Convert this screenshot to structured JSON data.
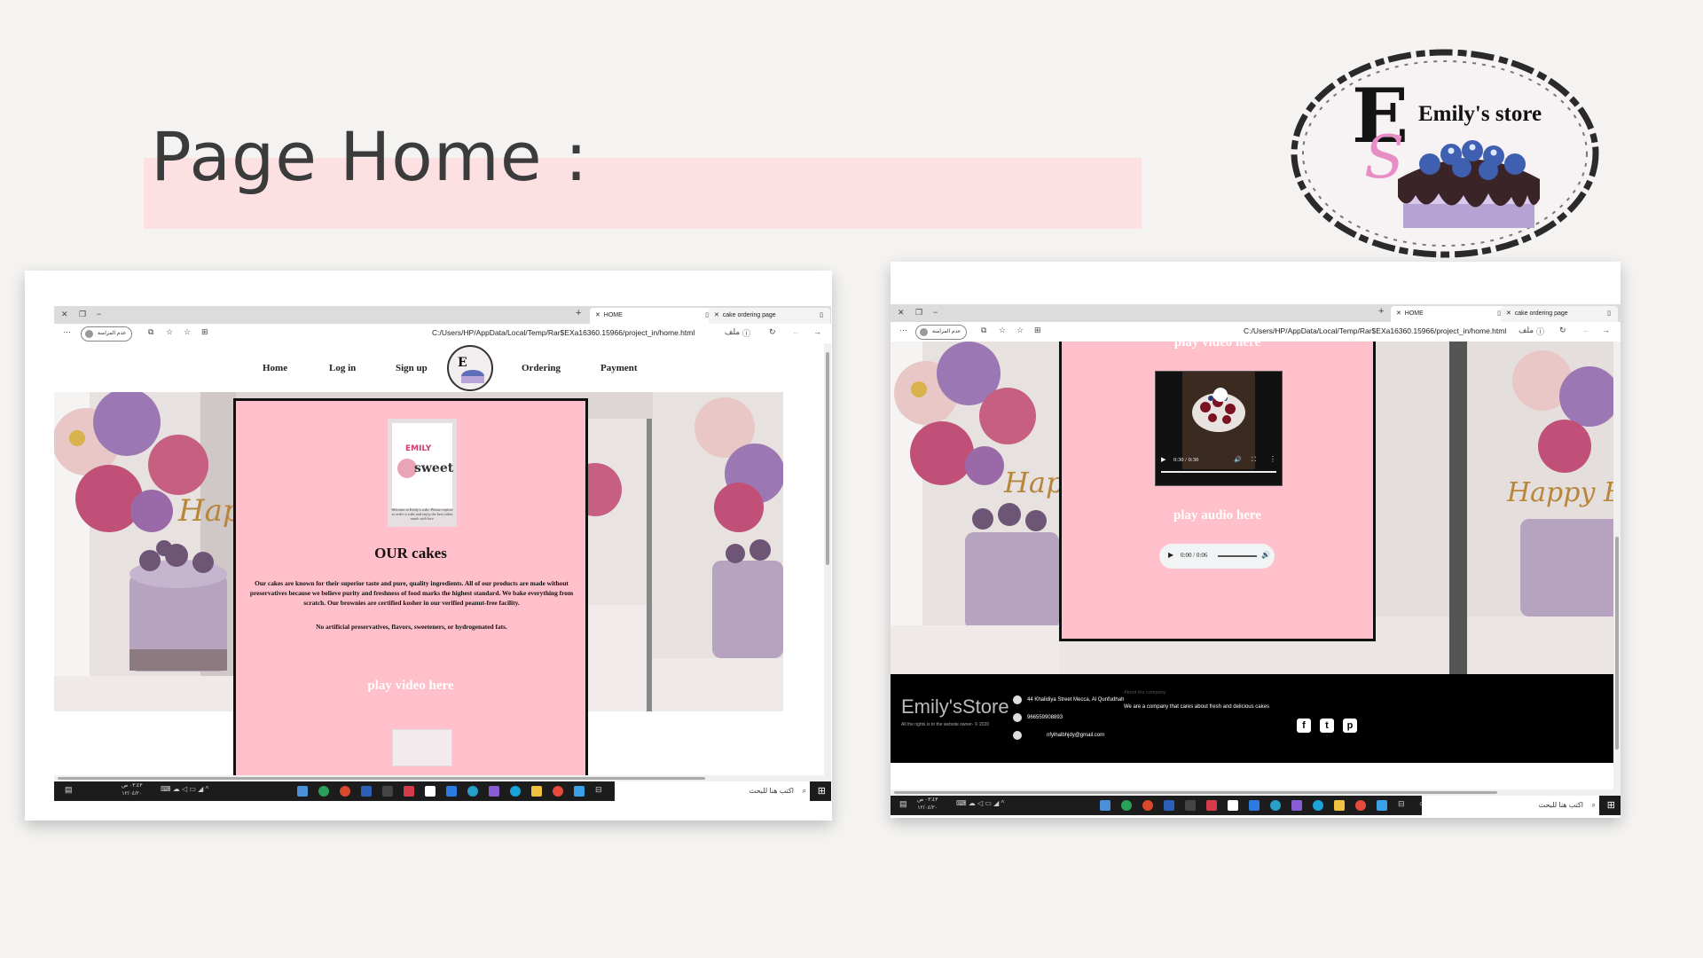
{
  "slide": {
    "title": "Page Home :",
    "logo_text": "Emily's store",
    "logo_monogram": "ES"
  },
  "browser": {
    "tab_home": "HOME",
    "tab_order": "cake ordering page",
    "profile_label": "عدم المزامنة",
    "url": "C:/Users/HP/AppData/Local/Temp/Rar$EXa16360.15966/project_in/home.html",
    "file_label": "ملف"
  },
  "taskbar": {
    "search_placeholder": "اكتب هنا للبحث",
    "time": "٠٣:٤٣ ص",
    "date": "١٢/٠٤/٢٠"
  },
  "left_page": {
    "nav": [
      "Home",
      "Log in",
      "Sign up",
      "Ordering",
      "Payment"
    ],
    "card_brand": "EMILY",
    "card_sweet": "sweet",
    "card_caption": "Welcome to Emily's cake. Please explore to order a cake and enjoy the best cakes made with love",
    "heading": "OUR cakes",
    "paragraph1": "Our cakes are known for their superior taste and pure, quality ingredients. All of our products are made without preservatives because we believe purity and freshness of food marks the highest standard. We bake everything from scratch. Our brownies are certified kosher in our verified peanut-free facility.",
    "paragraph2": "No artificial preservatives, flavors, sweeteners, or hydrogenated fats.",
    "video_label": "play video here",
    "balloon_text": "Happy Birthday"
  },
  "right_page": {
    "partial_heading": "play video here",
    "video_time": "0:30 / 0:30",
    "audio_label": "play audio here",
    "audio_time": "0:00 / 0:06",
    "footer_brand": "Emily'sStore",
    "footer_rights": "All the rights is to the website owner- © 2020",
    "address": "44 Khalidiya Street Mecca, Al Qunfudhah",
    "phone": "966559908893",
    "email": "nfylhalbhjdy@gmail.com",
    "about_title": "About the company",
    "about_text": "We are a company that cares about fresh and delicious cakes",
    "social": [
      "f",
      "t",
      "p"
    ]
  },
  "colors": {
    "pink": "#ffbfcb",
    "band": "#fde0e2",
    "footer": "#000000"
  }
}
